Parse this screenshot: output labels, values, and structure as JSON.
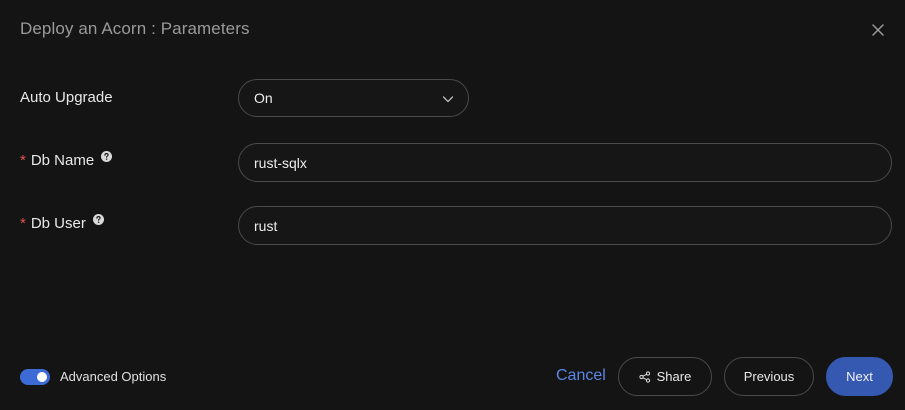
{
  "dialog": {
    "title": "Deploy an Acorn : Parameters"
  },
  "fields": {
    "auto_upgrade": {
      "label": "Auto Upgrade",
      "value": "On"
    },
    "db_name": {
      "required_mark": "*",
      "label": "Db Name",
      "value": "rust-sqlx"
    },
    "db_user": {
      "required_mark": "*",
      "label": "Db User",
      "value": "rust"
    }
  },
  "footer": {
    "advanced_options_label": "Advanced Options",
    "advanced_options_enabled": true,
    "cancel_label": "Cancel",
    "share_label": "Share",
    "previous_label": "Previous",
    "next_label": "Next"
  },
  "colors": {
    "accent": "#3d6bd6",
    "link": "#5b86e5",
    "required": "#e05252",
    "background": "#141414"
  },
  "icons": {
    "close": "close-icon",
    "help": "help-circle-icon",
    "chevron": "chevron-down-icon",
    "share": "share-icon"
  }
}
